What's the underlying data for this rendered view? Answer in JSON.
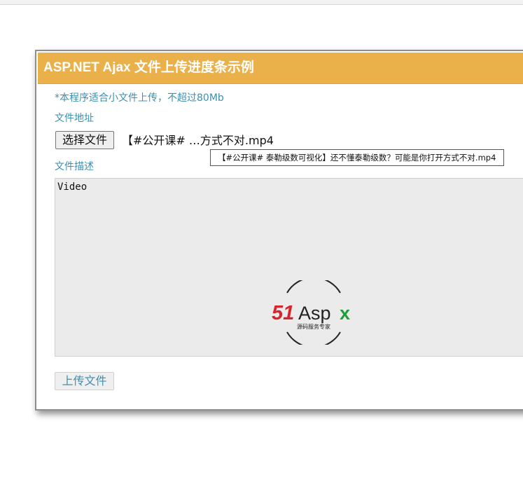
{
  "panel": {
    "title": "ASP.NET Ajax 文件上传进度条示例",
    "note": "*本程序适合小文件上传，不超过80Mb",
    "file_address_label": "文件地址",
    "choose_file_button": "选择文件",
    "selected_file_display": "【#公开课# …方式不对.mp4",
    "file_tooltip": "【#公开课# 泰勒级数可视化】还不懂泰勒级数？可能是你打开方式不对.mp4",
    "file_description_label": "文件描述",
    "file_description_value": "Video",
    "upload_button": "上传文件"
  },
  "watermark": {
    "brand": "51Aspx",
    "tagline": "源码服务专家"
  },
  "colors": {
    "header": "#eab04a",
    "accent_text": "#3c8fb0",
    "logo_red": "#d7262b",
    "logo_green": "#1e9e3a"
  }
}
